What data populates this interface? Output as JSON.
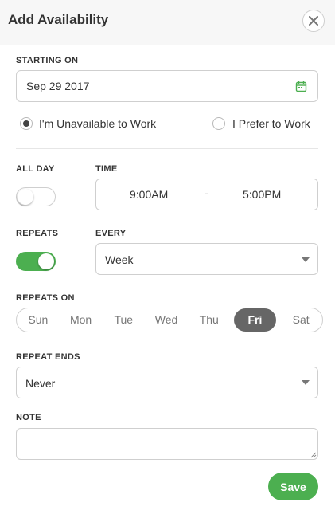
{
  "header": {
    "title": "Add Availability"
  },
  "starting_on": {
    "label": "STARTING ON",
    "value": "Sep 29 2017"
  },
  "availability_type": {
    "options": [
      {
        "label": "I'm Unavailable to Work",
        "checked": true
      },
      {
        "label": "I Prefer to Work",
        "checked": false
      }
    ]
  },
  "all_day": {
    "label": "ALL DAY",
    "on": false
  },
  "time": {
    "label": "TIME",
    "start": "9:00AM",
    "separator": "-",
    "end": "5:00PM"
  },
  "repeats": {
    "label": "REPEATS",
    "on": true
  },
  "every": {
    "label": "EVERY",
    "value": "Week"
  },
  "repeats_on": {
    "label": "REPEATS ON",
    "days": [
      "Sun",
      "Mon",
      "Tue",
      "Wed",
      "Thu",
      "Fri",
      "Sat"
    ],
    "selected": "Fri"
  },
  "repeat_ends": {
    "label": "REPEAT ENDS",
    "value": "Never"
  },
  "note": {
    "label": "NOTE",
    "value": ""
  },
  "actions": {
    "save_label": "Save"
  },
  "colors": {
    "accent": "#4caf50",
    "selected_day": "#666666",
    "header_bg": "#f7f7f7"
  }
}
